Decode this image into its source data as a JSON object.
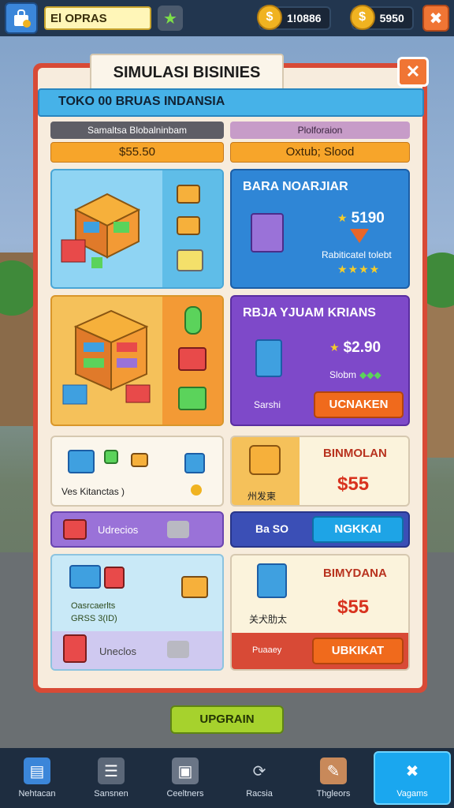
{
  "topbar": {
    "title_field": "El OPRAS",
    "currency_1": {
      "value": "1!0886",
      "icon": "coin-icon"
    },
    "currency_2": {
      "value": "5950",
      "icon": "coin-icon"
    }
  },
  "panel": {
    "title": "SIMULASI BISINIES",
    "banner": "TOKO 00 BRUAS INDANSIA",
    "stat_left": {
      "label": "Samaltsa Blobalninbam",
      "value": "$55.50"
    },
    "stat_right": {
      "label": "Plolforaion",
      "value": "Oxtub; Slood"
    }
  },
  "cards": {
    "card_a": {
      "title": "BARA NOARJIAR",
      "price": "5190",
      "sublabel": "Rabiticatel tolebt"
    },
    "card_b": {
      "title": "RBJA YJUAM KRIANS",
      "price": "$2.90",
      "sublabel": "Slobm",
      "caption": "Sarshi",
      "button": "UCNAKEN"
    },
    "card_c": {
      "caption": "Ves Kitanctas )"
    },
    "card_c_bar": {
      "label": "Udrecios"
    },
    "card_d": {
      "title": "BINMOLAN",
      "price": "$55",
      "caption": "州发柬"
    },
    "card_d_bar": {
      "label": "Ba SO",
      "button": "NGKKAI"
    },
    "card_e": {
      "caption_1": "Oasrcaerlts",
      "caption_2": "GRSS 3(ID)",
      "bar_label": "Uneclos"
    },
    "card_f": {
      "title": "BIMYDANA",
      "price": "$55",
      "caption": "关犬肋太",
      "bar_label": "Puaaey",
      "button": "UBKIKAT"
    }
  },
  "upgrade_button": "UPGRAIN",
  "bottom_nav": [
    {
      "label": "Nehtacan",
      "icon": "document-icon"
    },
    {
      "label": "Sansnen",
      "icon": "server-icon"
    },
    {
      "label": "Ceeltners",
      "icon": "camera-icon"
    },
    {
      "label": "Racsia",
      "icon": "refresh-icon"
    },
    {
      "label": "Thgleors",
      "icon": "pencil-icon"
    },
    {
      "label": "Vagams",
      "icon": "tools-icon"
    }
  ],
  "colors": {
    "panel_border": "#d84a36",
    "banner": "#46b2e8",
    "card_blue": "#2f86d6",
    "card_purple": "#7e49c9",
    "button_orange": "#f06a1c",
    "upgrade_green": "#a6d22d"
  }
}
